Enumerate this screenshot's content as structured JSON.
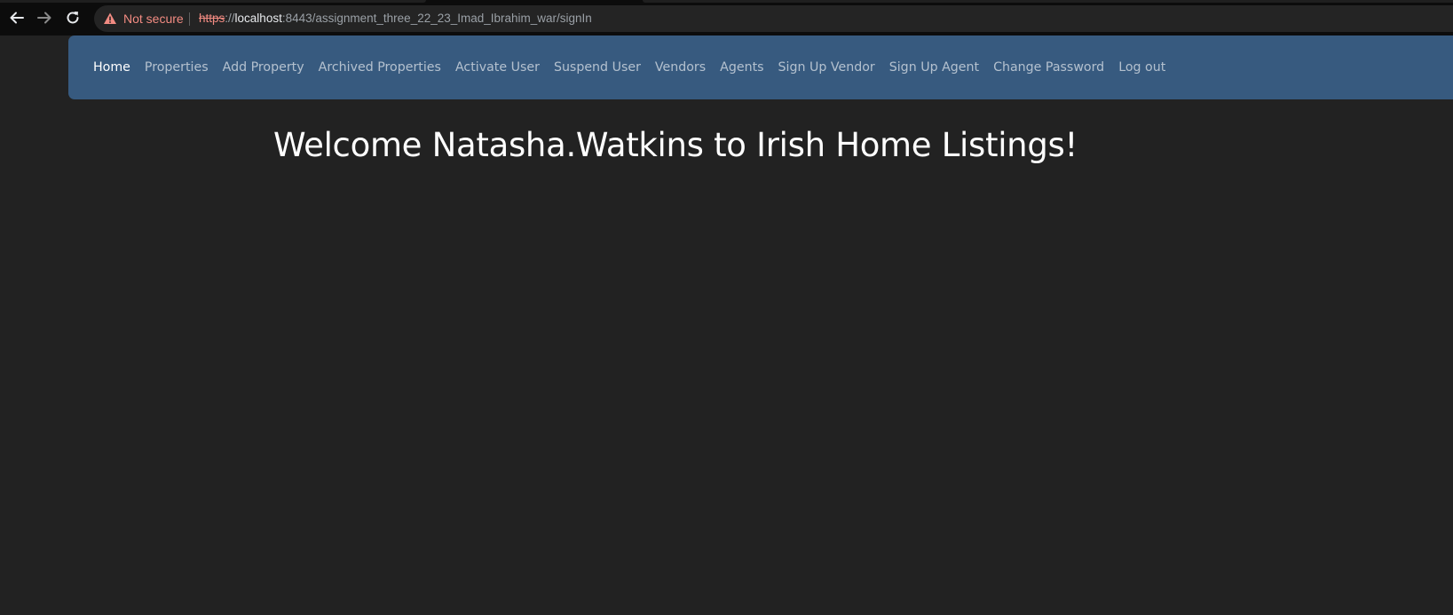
{
  "browser": {
    "back_icon": "arrow-left-icon",
    "forward_icon": "arrow-right-icon",
    "reload_icon": "reload-icon",
    "security_icon": "warning-triangle-icon",
    "security_label": "Not secure",
    "url": {
      "scheme": "https",
      "separator": "://",
      "host": "localhost",
      "rest": ":8443/assignment_three_22_23_Imad_Ibrahim_war/signIn"
    },
    "colors": {
      "not_secure": "#f28b82",
      "chrome_bg": "#0c0c0c"
    }
  },
  "navbar": {
    "background": "#375a7f",
    "items": [
      {
        "label": "Home",
        "active": true
      },
      {
        "label": "Properties",
        "active": false
      },
      {
        "label": "Add Property",
        "active": false
      },
      {
        "label": "Archived Properties",
        "active": false
      },
      {
        "label": "Activate User",
        "active": false
      },
      {
        "label": "Suspend User",
        "active": false
      },
      {
        "label": "Vendors",
        "active": false
      },
      {
        "label": "Agents",
        "active": false
      },
      {
        "label": "Sign Up Vendor",
        "active": false
      },
      {
        "label": "Sign Up Agent",
        "active": false
      },
      {
        "label": "Change Password",
        "active": false
      },
      {
        "label": "Log out",
        "active": false
      }
    ]
  },
  "main": {
    "welcome_text": "Welcome Natasha.Watkins to Irish Home Listings!",
    "background": "#222222"
  }
}
